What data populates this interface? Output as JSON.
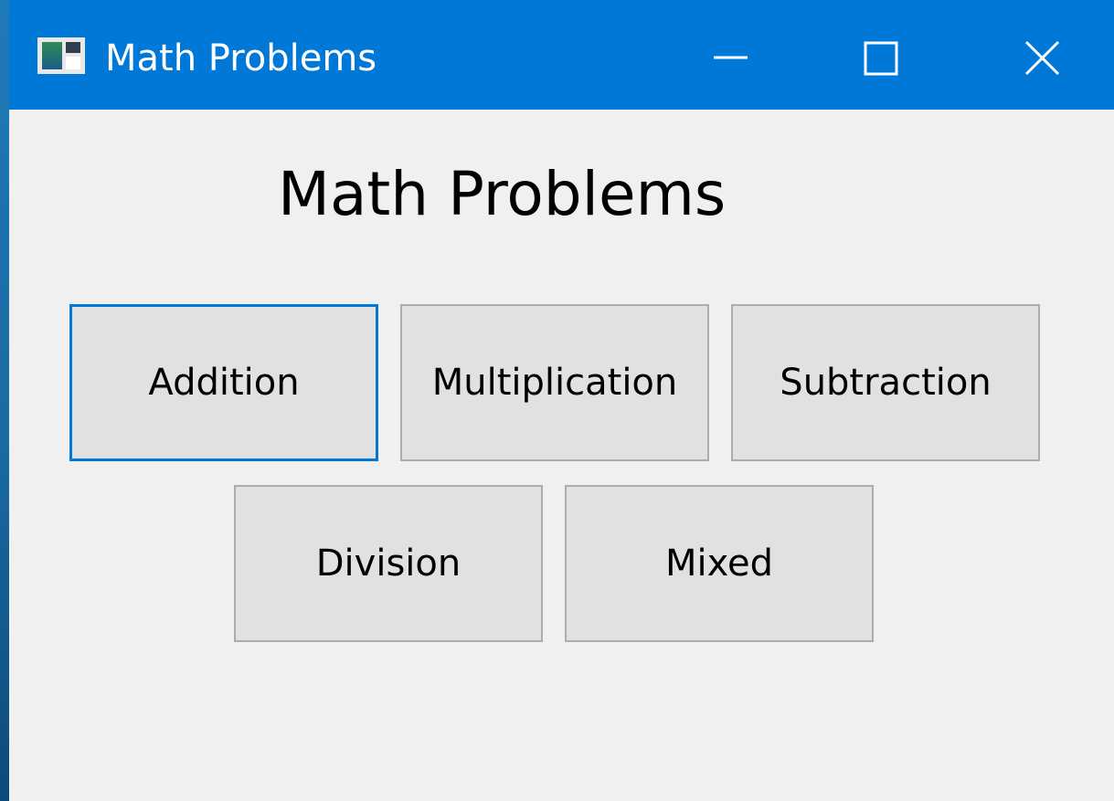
{
  "window": {
    "title": "Math Problems",
    "accent_color": "#0078d7",
    "background_color": "#f0f0f0",
    "icon": "app-window-icon",
    "controls": {
      "minimize_icon": "minimize-icon",
      "maximize_icon": "maximize-icon",
      "close_icon": "close-icon"
    }
  },
  "main": {
    "heading": "Math Problems",
    "buttons": [
      {
        "label": "Addition",
        "focused": true
      },
      {
        "label": "Multiplication",
        "focused": false
      },
      {
        "label": "Subtraction",
        "focused": false
      },
      {
        "label": "Division",
        "focused": false
      },
      {
        "label": "Mixed",
        "focused": false
      }
    ]
  }
}
